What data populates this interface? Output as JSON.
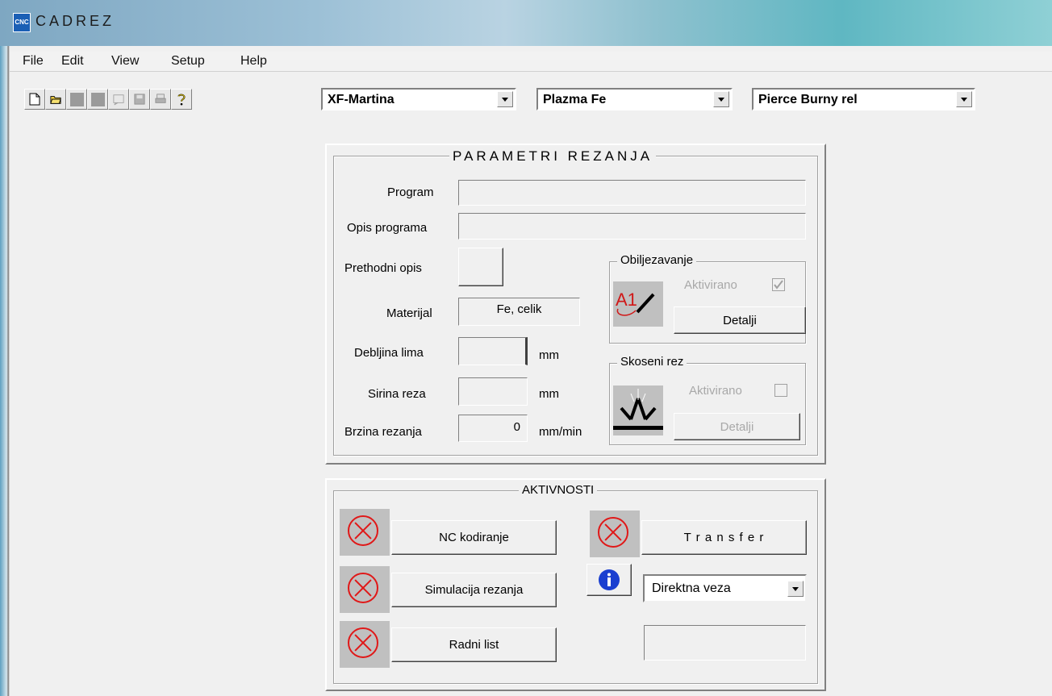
{
  "window": {
    "title": "CADREZ",
    "icon_label": "CNC"
  },
  "menu": [
    "File",
    "Edit",
    "View",
    "Setup",
    "Help"
  ],
  "toolbar": {
    "buttons": [
      "new-file-icon",
      "open-folder-icon",
      "disabled-icon",
      "disabled-icon",
      "memo-icon",
      "save-icon",
      "print-icon",
      "help-icon"
    ],
    "combos": [
      "XF-Martina",
      "Plazma Fe",
      "Pierce Burny rel"
    ]
  },
  "params": {
    "title": "PARAMETRI REZANJA",
    "program_label": "Program",
    "program_value": "",
    "opis_label": "Opis programa",
    "opis_value": "",
    "prethodni_label": "Prethodni opis",
    "materijal_label": "Materijal",
    "materijal_value": "Fe, celik",
    "debljina_label": "Debljina lima",
    "debljina_value": "",
    "debljina_unit": "mm",
    "sirina_label": "Sirina reza",
    "sirina_value": "",
    "sirina_unit": "mm",
    "brzina_label": "Brzina rezanja",
    "brzina_value": "0",
    "brzina_unit": "mm/min"
  },
  "obiljezavanje": {
    "title": "Obiljezavanje",
    "aktivirano": "Aktivirano",
    "checked": true,
    "detalji": "Detalji"
  },
  "skoseni": {
    "title": "Skoseni rez",
    "aktivirano": "Aktivirano",
    "checked": false,
    "detalji": "Detalji"
  },
  "aktivnosti": {
    "title": "AKTIVNOSTI",
    "nc": "NC kodiranje",
    "simulacija": "Simulacija rezanja",
    "radni": "Radni list",
    "transfer": "T r a n s f e r",
    "connection": "Direktna veza",
    "status_value": ""
  },
  "colors": {
    "status_red": "#e01818",
    "info_blue": "#1a3fd0"
  }
}
